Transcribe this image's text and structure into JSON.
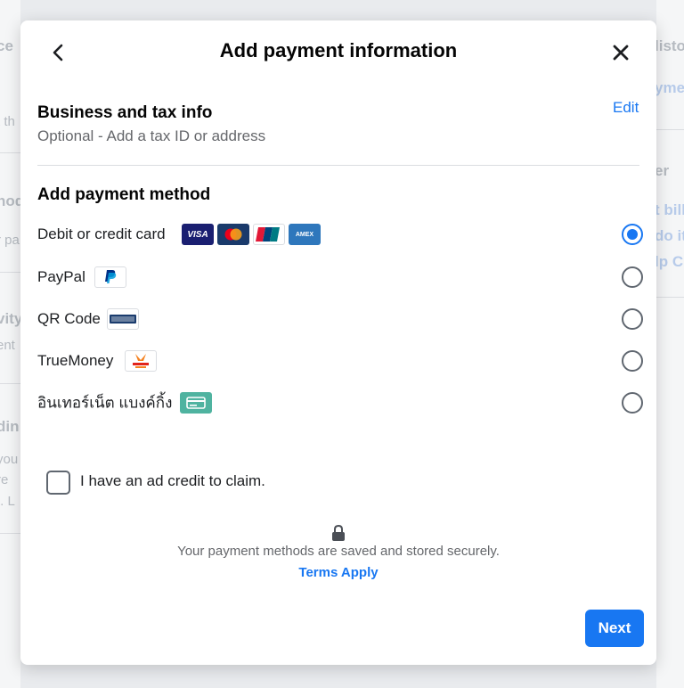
{
  "background": {
    "left_fragments": [
      "ce",
      "t th",
      "hod",
      "r pa",
      "vity",
      "ent",
      "din",
      "you",
      "re",
      "t. L"
    ],
    "right_fragments": [
      "listo",
      "ymer",
      "er",
      "t bill",
      "do it",
      "lp C"
    ]
  },
  "modal": {
    "title": "Add payment information",
    "back_icon": "chevron-left-icon",
    "close_icon": "close-icon"
  },
  "business": {
    "title": "Business and tax info",
    "subtitle": "Optional - Add a tax ID or address",
    "edit_label": "Edit"
  },
  "payment": {
    "title": "Add payment method",
    "methods": [
      {
        "label": "Debit or credit card",
        "selected": true,
        "logos": [
          "VISA",
          "mastercard",
          "UnionPay",
          "AMEX"
        ]
      },
      {
        "label": "PayPal",
        "selected": false,
        "logos": [
          "PayPal"
        ]
      },
      {
        "label": "QR Code",
        "selected": false,
        "logos": [
          "PromptPay"
        ]
      },
      {
        "label": "TrueMoney",
        "selected": false,
        "logos": [
          "truemoney"
        ]
      },
      {
        "label": "อินเทอร์เน็ต แบงค์กิ้ง",
        "selected": false,
        "logos": [
          "bank-card-icon"
        ]
      }
    ]
  },
  "ad_credit": {
    "label": "I have an ad credit to claim.",
    "checked": false
  },
  "security": {
    "icon": "lock-icon",
    "text": "Your payment methods are saved and stored securely.",
    "terms_label": "Terms Apply"
  },
  "footer": {
    "next_label": "Next"
  },
  "colors": {
    "accent": "#1877f2",
    "visa": "#1a1f71",
    "mastercard_bg": "#1a3a6b",
    "amex": "#2e77bc",
    "bank_icon": "#4fb3a0"
  }
}
